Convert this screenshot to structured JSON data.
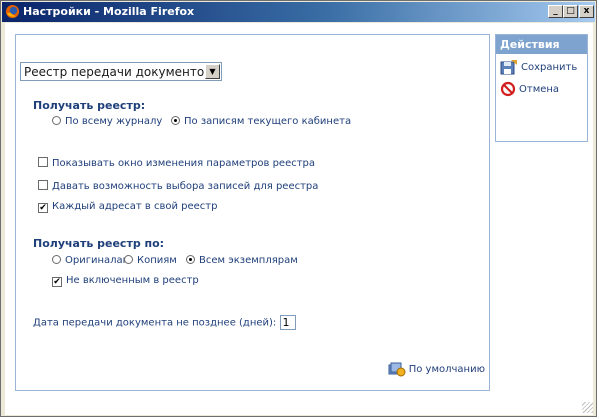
{
  "window": {
    "title": "Настройки - Mozilla Firefox",
    "controls": {
      "minimize": "_",
      "maximize": "□",
      "close": "x"
    }
  },
  "report_select": {
    "value": "Реестр передачи документов"
  },
  "get_registry": {
    "title": "Получать реестр:",
    "options": [
      {
        "label": "По всему журналу",
        "selected": false
      },
      {
        "label": "По записям текущего кабинета",
        "selected": true
      }
    ]
  },
  "checkboxes": [
    {
      "label": "Показывать окно изменения параметров реестра",
      "checked": false
    },
    {
      "label": "Давать возможность выбора записей для реестра",
      "checked": false
    },
    {
      "label": "Каждый адресат в свой реестр",
      "checked": true
    }
  ],
  "get_registry_by": {
    "title": "Получать реестр по:",
    "options": [
      {
        "label": "Оригиналам",
        "selected": false
      },
      {
        "label": "Копиям",
        "selected": false
      },
      {
        "label": "Всем экземплярам",
        "selected": true
      }
    ],
    "not_included": {
      "label": "Не включенным в реестр",
      "checked": true
    }
  },
  "date_field": {
    "label": "Дата передачи документа не позднее (дней):",
    "value": "1"
  },
  "default_button": {
    "label": "По умолчанию"
  },
  "actions": {
    "header": "Действия",
    "save": "Сохранить",
    "cancel": "Отмена"
  },
  "colors": {
    "title_gradient_start": "#0a246a",
    "panel_border": "#9bb5d9",
    "actions_header": "#7ea3cf",
    "text_blue": "#1f3f7a"
  }
}
